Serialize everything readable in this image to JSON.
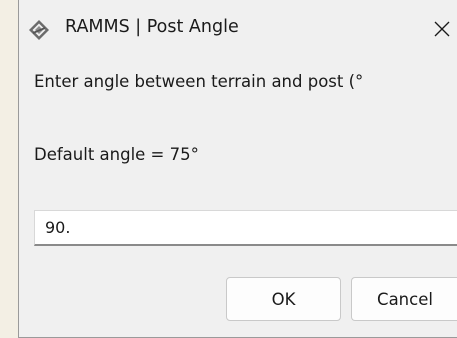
{
  "window": {
    "title": "RAMMS | Post Angle",
    "icon": "ramms-app-icon",
    "close_icon": "close-icon"
  },
  "dialog": {
    "prompt": "Enter angle between terrain and post (°",
    "default_note": "Default angle = 75°",
    "angle_value": "90."
  },
  "buttons": {
    "ok_label": "OK",
    "cancel_label": "Cancel"
  }
}
